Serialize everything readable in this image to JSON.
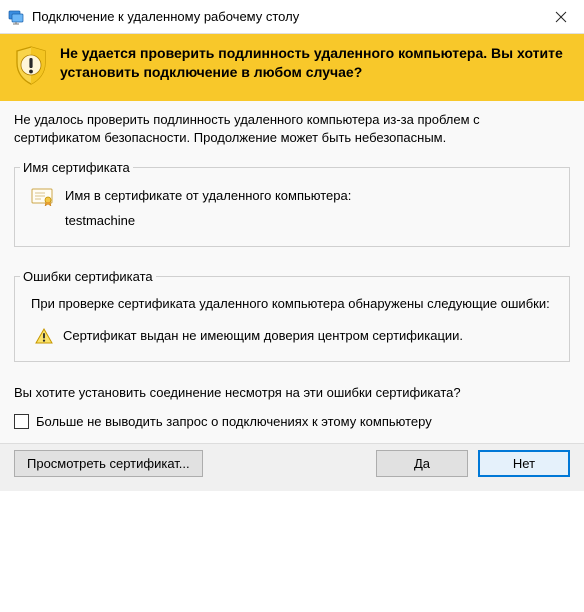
{
  "titlebar": {
    "title": "Подключение к удаленному рабочему столу"
  },
  "banner": {
    "text": "Не удается проверить подлинность удаленного компьютера. Вы хотите установить подключение в любом случае?"
  },
  "explain": "Не удалось проверить подлинность удаленного компьютера из-за проблем с сертификатом безопасности. Продолжение может быть небезопасным.",
  "cert_group": {
    "title": "Имя сертификата",
    "label": "Имя в сертификате от удаленного компьютера:",
    "value": "testmachine"
  },
  "errors_group": {
    "title": "Ошибки сертификата",
    "intro": "При проверке сертификата удаленного компьютера обнаружены следующие ошибки:",
    "items": [
      "Сертификат выдан не имеющим доверия центром сертификации."
    ]
  },
  "prompt": "Вы хотите установить соединение несмотря на эти ошибки сертификата?",
  "checkbox": {
    "label": "Больше не выводить запрос о подключениях к этому компьютеру"
  },
  "buttons": {
    "view_cert": "Просмотреть сертификат...",
    "yes": "Да",
    "no": "Нет"
  }
}
